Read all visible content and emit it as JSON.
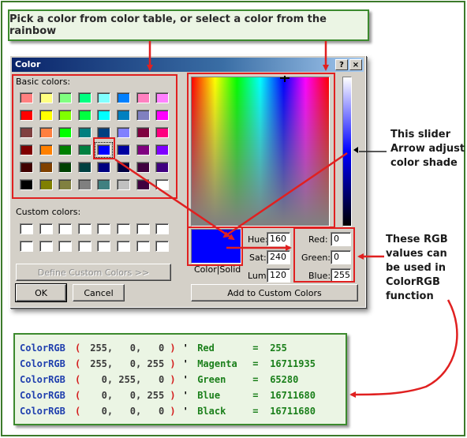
{
  "callout_top": "Pick a color from color table, or select a color from the rainbow",
  "dialog": {
    "title": "Color",
    "help_label": "?",
    "close_label": "×",
    "basic_colors_label": "Basic colors:",
    "custom_colors_label": "Custom colors:",
    "define_custom_label": "Define Custom Colors >>",
    "ok_label": "OK",
    "cancel_label": "Cancel",
    "color_solid_label": "Color|Solid",
    "add_custom_label": "Add to Custom Colors",
    "hue_label": "Hue:",
    "hue": "160",
    "sat_label": "Sat:",
    "sat": "240",
    "lum_label": "Lum:",
    "lum": "120",
    "red_label": "Red:",
    "red": "0",
    "green_label": "Green:",
    "green": "0",
    "blue_label": "Blue:",
    "blue": "255",
    "selected_basic_index": 28,
    "basic_colors": [
      "#ff8080",
      "#ffff80",
      "#80ff80",
      "#00ff80",
      "#80ffff",
      "#0080ff",
      "#ff80c0",
      "#ff80ff",
      "#ff0000",
      "#ffff00",
      "#80ff00",
      "#00ff40",
      "#00ffff",
      "#0080c0",
      "#8080c0",
      "#ff00ff",
      "#804040",
      "#ff8040",
      "#00ff00",
      "#008080",
      "#004080",
      "#8080ff",
      "#800040",
      "#ff0080",
      "#800000",
      "#ff8000",
      "#008000",
      "#008040",
      "#0000ff",
      "#0000a0",
      "#800080",
      "#8000ff",
      "#400000",
      "#804000",
      "#004000",
      "#004040",
      "#000080",
      "#000040",
      "#400040",
      "#400080",
      "#000000",
      "#808000",
      "#808040",
      "#808080",
      "#408080",
      "#c0c0c0",
      "#400040",
      "#ffffff"
    ]
  },
  "annotations": {
    "slider": [
      "This slider",
      "Arrow adjust",
      "color shade"
    ],
    "rgb": [
      "These RGB",
      "values can",
      "be used in",
      "ColorRGB",
      "function"
    ]
  },
  "code_lines": [
    {
      "fn": "ColorRGB",
      "r": "255",
      "g": "0",
      "b": "0",
      "name": "Red",
      "value": "255"
    },
    {
      "fn": "ColorRGB",
      "r": "255",
      "g": "0",
      "b": "255",
      "name": "Magenta",
      "value": "16711935"
    },
    {
      "fn": "ColorRGB",
      "r": "0",
      "g": "255",
      "b": "0",
      "name": "Green",
      "value": "65280"
    },
    {
      "fn": "ColorRGB",
      "r": "0",
      "g": "0",
      "b": "255",
      "name": "Blue",
      "value": "16711680"
    },
    {
      "fn": "ColorRGB",
      "r": "0",
      "g": "0",
      "b": "0",
      "name": "Black",
      "value": "16711680"
    }
  ],
  "colors": {
    "accent_green": "#3c8a2e",
    "highlight_red": "#e02020",
    "code_function": "#1f3fae",
    "code_name": "#1a7f1a"
  }
}
